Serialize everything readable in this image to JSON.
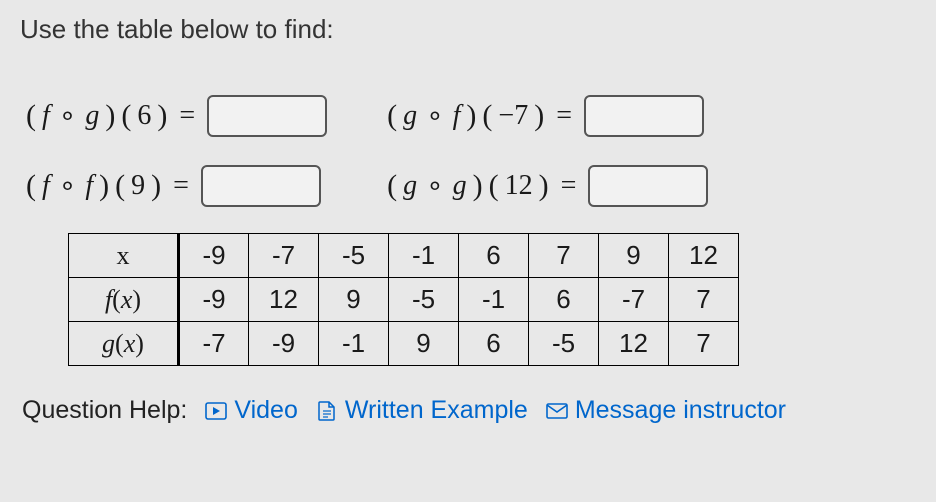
{
  "instruction": "Use the table below to find:",
  "equations": {
    "e1": {
      "func1": "f",
      "func2": "g",
      "arg": "6"
    },
    "e2": {
      "func1": "g",
      "func2": "f",
      "arg": "−7"
    },
    "e3": {
      "func1": "f",
      "func2": "f",
      "arg": "9"
    },
    "e4": {
      "func1": "g",
      "func2": "g",
      "arg": "12"
    }
  },
  "table": {
    "row_labels": {
      "x": "x",
      "fx_f": "f",
      "fx_x": "x",
      "gx_g": "g",
      "gx_x": "x"
    },
    "x": [
      "-9",
      "-7",
      "-5",
      "-1",
      "6",
      "7",
      "9",
      "12"
    ],
    "fx": [
      "-9",
      "12",
      "9",
      "-5",
      "-1",
      "6",
      "-7",
      "7"
    ],
    "gx": [
      "-7",
      "-9",
      "-1",
      "9",
      "6",
      "-5",
      "12",
      "7"
    ]
  },
  "help": {
    "label": "Question Help:",
    "video": "Video",
    "written": "Written Example",
    "message": "Message instructor"
  },
  "chart_data": {
    "type": "table",
    "columns": [
      "x",
      "f(x)",
      "g(x)"
    ],
    "rows": [
      {
        "x": -9,
        "f(x)": -9,
        "g(x)": -7
      },
      {
        "x": -7,
        "f(x)": 12,
        "g(x)": -9
      },
      {
        "x": -5,
        "f(x)": 9,
        "g(x)": -1
      },
      {
        "x": -1,
        "f(x)": -5,
        "g(x)": 9
      },
      {
        "x": 6,
        "f(x)": -1,
        "g(x)": 6
      },
      {
        "x": 7,
        "f(x)": 6,
        "g(x)": -5
      },
      {
        "x": 9,
        "f(x)": -7,
        "g(x)": 12
      },
      {
        "x": 12,
        "f(x)": 7,
        "g(x)": 7
      }
    ]
  }
}
